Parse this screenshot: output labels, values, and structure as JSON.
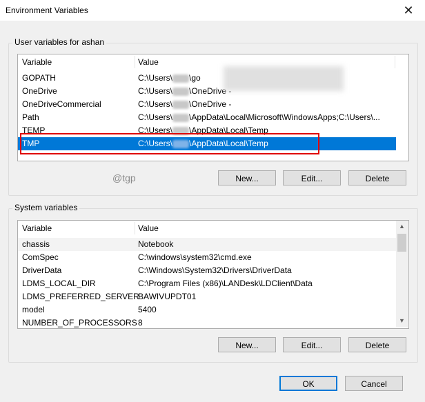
{
  "window": {
    "title": "Environment Variables",
    "close_glyph": "✕"
  },
  "user_vars": {
    "label": "User variables for ashan",
    "columns": {
      "variable": "Variable",
      "value": "Value"
    },
    "rows": [
      {
        "name": "GOPATH",
        "prefix": "C:\\Users\\",
        "suffix": "\\go"
      },
      {
        "name": "OneDrive",
        "prefix": "C:\\Users\\",
        "suffix": "\\OneDrive -"
      },
      {
        "name": "OneDriveCommercial",
        "prefix": "C:\\Users\\",
        "suffix": "\\OneDrive -"
      },
      {
        "name": "Path",
        "prefix": "C:\\Users\\",
        "suffix": "\\AppData\\Local\\Microsoft\\WindowsApps;C:\\Users\\..."
      },
      {
        "name": "TEMP",
        "prefix": "C:\\Users\\",
        "suffix": "\\AppData\\Local\\Temp"
      },
      {
        "name": "TMP",
        "prefix": "C:\\Users\\",
        "suffix": "\\AppData\\Local\\Temp"
      }
    ],
    "buttons": {
      "new": "New...",
      "edit": "Edit...",
      "delete": "Delete"
    }
  },
  "watermark": "@tgp",
  "system_vars": {
    "label": "System variables",
    "columns": {
      "variable": "Variable",
      "value": "Value"
    },
    "rows": [
      {
        "name": "chassis",
        "value": "Notebook"
      },
      {
        "name": "ComSpec",
        "value": "C:\\windows\\system32\\cmd.exe"
      },
      {
        "name": "DriverData",
        "value": "C:\\Windows\\System32\\Drivers\\DriverData"
      },
      {
        "name": "LDMS_LOCAL_DIR",
        "value": "C:\\Program Files (x86)\\LANDesk\\LDClient\\Data"
      },
      {
        "name": "LDMS_PREFERRED_SERVER",
        "value": "BAWIVUPDT01"
      },
      {
        "name": "model",
        "value": "5400"
      },
      {
        "name": "NUMBER_OF_PROCESSORS",
        "value": "8"
      }
    ],
    "buttons": {
      "new": "New...",
      "edit": "Edit...",
      "delete": "Delete"
    }
  },
  "footer": {
    "ok": "OK",
    "cancel": "Cancel"
  },
  "colors": {
    "selection": "#0078d7",
    "highlight_box": "#e00000"
  }
}
